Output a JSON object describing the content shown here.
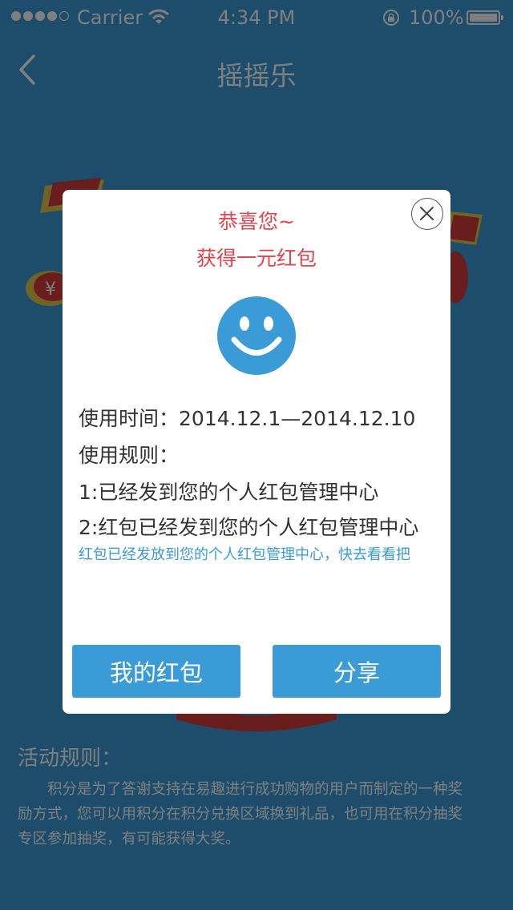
{
  "status_bar": {
    "carrier": "Carrier",
    "time": "4:34 PM",
    "battery": "100%"
  },
  "nav": {
    "title": "摇摇乐"
  },
  "activity_rules": {
    "title": "活动规则：",
    "text": "积分是为了答谢支持在易趣进行成功购物的用户而制定的一种奖励方式，您可以用积分在积分兑换区域换到礼品，也可用在积分抽奖专区参加抽奖，有可能获得大奖。"
  },
  "modal": {
    "congrats": "恭喜您~",
    "prize": "获得一元红包",
    "usage_time_label": "使用时间：",
    "usage_time_value": "2014.12.1—2014.12.10",
    "rules_label": "使用规则：",
    "rule_1": "1:已经发到您的个人红包管理中心",
    "rule_2": "2:红包已经发到您的个人红包管理中心",
    "hint": "红包已经发放到您的个人红包管理中心，快去看看把",
    "my_packet_button": "我的红包",
    "share_button": "分享"
  },
  "colors": {
    "brand_blue": "#3a9bd6",
    "accent_red": "#e0444c"
  }
}
